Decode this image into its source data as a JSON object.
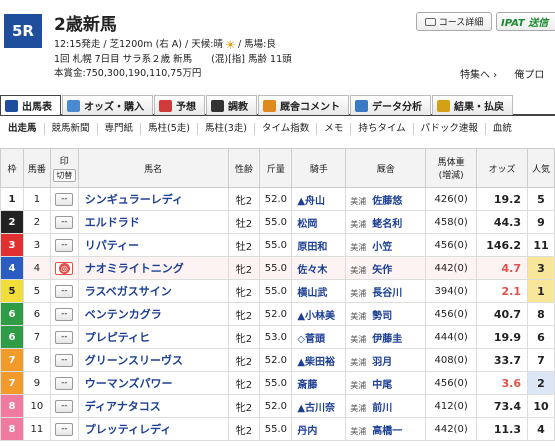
{
  "race": {
    "number": "5R",
    "title": "2歳新馬",
    "info_line1_a": "12:15発走 / 芝1200m (右 A) / 天候:晴",
    "info_line1_b": "/ 馬場:良",
    "info_line2": "1回 札幌 7日目 サラ系２歳 新馬　　(混)[指] 馬齢 11頭",
    "info_line3": "本賞金:750,300,190,110,75万円"
  },
  "buttons": {
    "course": "コース詳細",
    "ipat": "IPAT 送信"
  },
  "top_links": [
    "特集へ ›",
    "俺プロ"
  ],
  "main_tabs": [
    {
      "label": "出馬表",
      "icon": "table-icon",
      "color": "#1f4e9c"
    },
    {
      "label": "オッズ・購入",
      "icon": "odds-icon",
      "color": "#4a8ad1"
    },
    {
      "label": "予想",
      "icon": "target-icon",
      "color": "#d13a3a"
    },
    {
      "label": "調教",
      "icon": "stopwatch-icon",
      "color": "#333333"
    },
    {
      "label": "厩舎コメント",
      "icon": "comment-icon",
      "color": "#e08a1e"
    },
    {
      "label": "データ分析",
      "icon": "bar-chart-icon",
      "color": "#3a7ac4"
    },
    {
      "label": "結果・払戻",
      "icon": "coins-icon",
      "color": "#d4a017"
    }
  ],
  "sub_tabs": [
    "出走馬",
    "競馬新聞",
    "専門紙",
    "馬柱(5走)",
    "馬柱(3走)",
    "タイム指数",
    "メモ",
    "持ちタイム",
    "パドック速報",
    "血統"
  ],
  "columns": {
    "waku": "枠",
    "uma": "馬番",
    "mark": "印",
    "mark_sub": "切替",
    "name": "馬名",
    "sex": "性齢",
    "kin": "斤量",
    "jockey": "騎手",
    "stable": "厩舎",
    "weight": "馬体重",
    "weight_sub": "(増減)",
    "odds": "オッズ",
    "pop": "人気"
  },
  "frame_colors": {
    "1": {
      "bg": "#ffffff",
      "fg": "#222222"
    },
    "2": {
      "bg": "#222222",
      "fg": "#ffffff"
    },
    "3": {
      "bg": "#e03030",
      "fg": "#ffffff"
    },
    "4": {
      "bg": "#2a5cc2",
      "fg": "#ffffff"
    },
    "5": {
      "bg": "#f2de3a",
      "fg": "#222222"
    },
    "6": {
      "bg": "#2e9d46",
      "fg": "#ffffff"
    },
    "7": {
      "bg": "#f39a2c",
      "fg": "#ffffff"
    },
    "8": {
      "bg": "#f07aa0",
      "fg": "#ffffff"
    }
  },
  "horses": [
    {
      "waku": "1",
      "uma": "1",
      "mark": "--",
      "name": "シンギュラーレディ",
      "sex": "牝2",
      "kin": "52.0",
      "jockey": "▲舟山",
      "region": "美浦",
      "trainer": "佐藤悠",
      "weight": "426(0)",
      "odds": "19.2",
      "pop": "5",
      "hot": false
    },
    {
      "waku": "2",
      "uma": "2",
      "mark": "--",
      "name": "エルドラド",
      "sex": "牡2",
      "kin": "55.0",
      "jockey": "松岡",
      "region": "美浦",
      "trainer": "蛯名利",
      "weight": "458(0)",
      "odds": "44.3",
      "pop": "9",
      "hot": false
    },
    {
      "waku": "3",
      "uma": "3",
      "mark": "--",
      "name": "リパティー",
      "sex": "牡2",
      "kin": "55.0",
      "jockey": "原田和",
      "region": "美浦",
      "trainer": "小笠",
      "weight": "456(0)",
      "odds": "146.2",
      "pop": "11",
      "hot": false
    },
    {
      "waku": "4",
      "uma": "4",
      "mark": "◎",
      "name": "ナオミライトニング",
      "sex": "牝2",
      "kin": "55.0",
      "jockey": "佐々木",
      "region": "美浦",
      "trainer": "矢作",
      "weight": "442(0)",
      "odds": "4.7",
      "pop": "3",
      "hot": true
    },
    {
      "waku": "5",
      "uma": "5",
      "mark": "--",
      "name": "ラスベガスサイン",
      "sex": "牝2",
      "kin": "55.0",
      "jockey": "横山武",
      "region": "美浦",
      "trainer": "長谷川",
      "weight": "394(0)",
      "odds": "2.1",
      "pop": "1",
      "hot": true
    },
    {
      "waku": "6",
      "uma": "6",
      "mark": "--",
      "name": "ベンテンカグラ",
      "sex": "牝2",
      "kin": "52.0",
      "jockey": "▲小林美",
      "region": "美浦",
      "trainer": "勢司",
      "weight": "456(0)",
      "odds": "40.7",
      "pop": "8",
      "hot": false
    },
    {
      "waku": "6",
      "uma": "7",
      "mark": "--",
      "name": "プレピティヒ",
      "sex": "牝2",
      "kin": "53.0",
      "jockey": "◇菅頭",
      "region": "美浦",
      "trainer": "伊藤圭",
      "weight": "444(0)",
      "odds": "19.9",
      "pop": "6",
      "hot": false
    },
    {
      "waku": "7",
      "uma": "8",
      "mark": "--",
      "name": "グリーンスリーヴス",
      "sex": "牝2",
      "kin": "52.0",
      "jockey": "▲柴田裕",
      "region": "美浦",
      "trainer": "羽月",
      "weight": "408(0)",
      "odds": "33.7",
      "pop": "7",
      "hot": false
    },
    {
      "waku": "7",
      "uma": "9",
      "mark": "--",
      "name": "ウーマンズパワー",
      "sex": "牝2",
      "kin": "55.0",
      "jockey": "斎藤",
      "region": "美浦",
      "trainer": "中尾",
      "weight": "456(0)",
      "odds": "3.6",
      "pop": "2",
      "hot": true
    },
    {
      "waku": "8",
      "uma": "10",
      "mark": "--",
      "name": "ディアナタコス",
      "sex": "牝2",
      "kin": "52.0",
      "jockey": "▲古川奈",
      "region": "美浦",
      "trainer": "前川",
      "weight": "412(0)",
      "odds": "73.4",
      "pop": "10",
      "hot": false
    },
    {
      "waku": "8",
      "uma": "11",
      "mark": "--",
      "name": "プレッティレディ",
      "sex": "牝2",
      "kin": "55.0",
      "jockey": "丹内",
      "region": "美浦",
      "trainer": "高橋一",
      "weight": "442(0)",
      "odds": "11.3",
      "pop": "4",
      "hot": false
    }
  ]
}
